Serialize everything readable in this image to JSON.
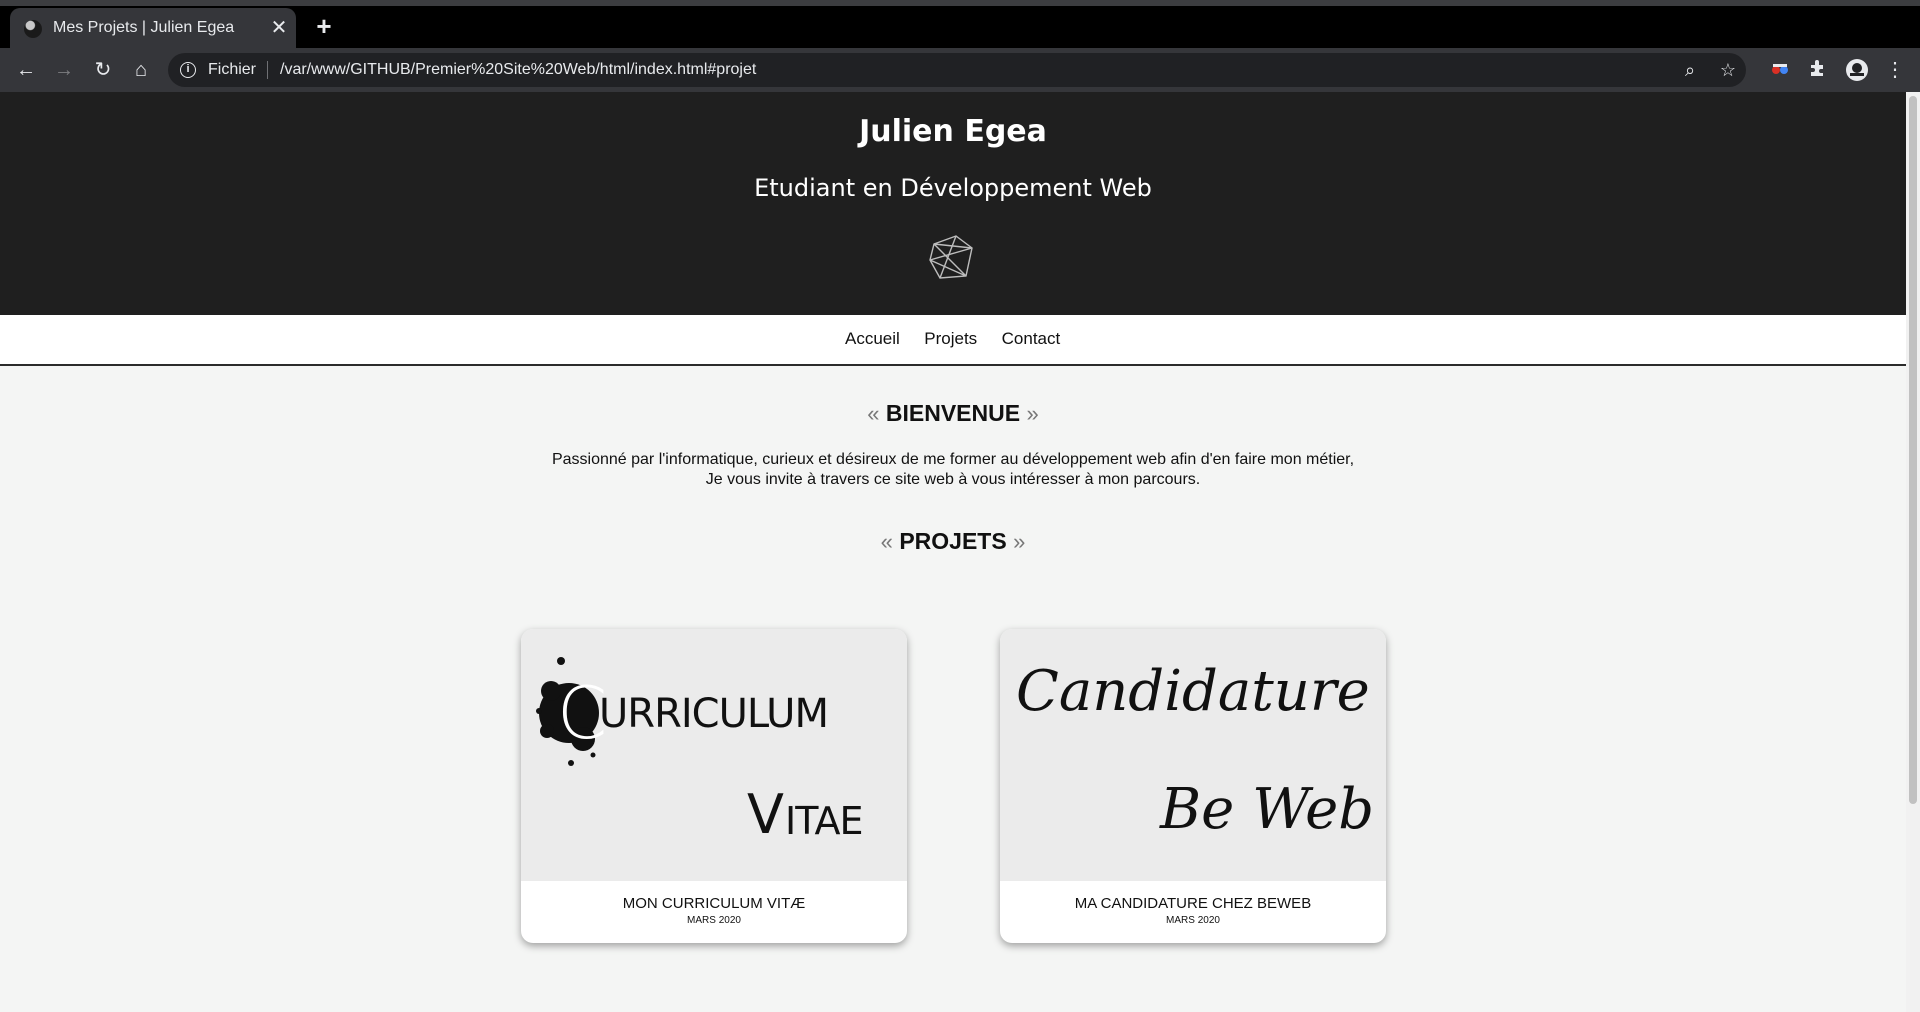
{
  "browser": {
    "tab_title": "Mes Projets | Julien Egea",
    "scheme_label": "Fichier",
    "url": "/var/www/GITHUB/Premier%20Site%20Web/html/index.html#projet"
  },
  "header": {
    "name": "Julien Egea",
    "subtitle": "Etudiant en Développement Web"
  },
  "nav": {
    "items": [
      "Accueil",
      "Projets",
      "Contact"
    ]
  },
  "welcome": {
    "quote_open": "«",
    "title": "BIENVENUE",
    "quote_close": "»",
    "line1": "Passionné par l'informatique, curieux et désireux de me former au développement web afin d'en faire mon métier,",
    "line2": "Je vous invite à travers ce site web à vous intéresser à mon parcours."
  },
  "projects": {
    "quote_open": "«",
    "title": "PROJETS",
    "quote_close": "»",
    "cards": [
      {
        "image_text_1": "C",
        "image_text_2": "URRICULUM",
        "image_text_3": "V",
        "image_text_4": "ITAE",
        "title": "MON CURRICULUM VITÆ",
        "date": "MARS 2020"
      },
      {
        "image_text_1": "Candidature",
        "image_text_2": "Be Web",
        "title": "MA CANDIDATURE CHEZ BEWEB",
        "date": "MARS 2020"
      }
    ]
  },
  "colors": {
    "header_bg": "#1f1f1f",
    "page_bg": "#f4f5f4",
    "card_image_bg": "#ebebeb"
  }
}
